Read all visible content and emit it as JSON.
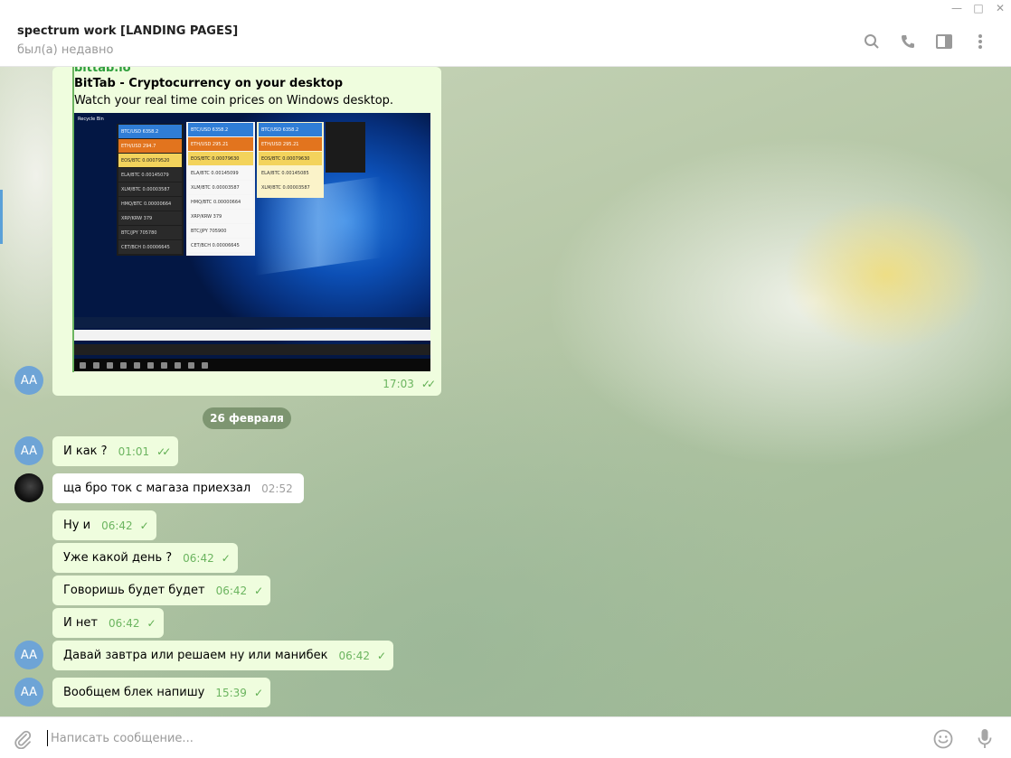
{
  "header": {
    "title": "spectrum work [LANDING PAGES]",
    "status": "был(а) недавно"
  },
  "link_preview": {
    "site": "bittab.io",
    "title": "BitTab - Cryptocurrency on your desktop",
    "description": "Watch your real time coin prices on Windows desktop.",
    "time": "17:03",
    "image_rows": {
      "col1": [
        "BTC/USD 6358.2",
        "ETH/USD 294.7",
        "EOS/BTC 0.00079520",
        "ELA/BTC 0.00145079",
        "XLM/BTC 0.00003587",
        "HMQ/BTC 0.00000664",
        "XRP/KRW 379",
        "BTC/JPY 705780",
        "CET/BCH 0.00006645"
      ],
      "col2": [
        "BTC/USD 6358.2",
        "ETH/USD 295.21",
        "EOS/BTC 0.00079630",
        "ELA/BTC 0.00145099",
        "XLM/BTC 0.00003587",
        "HMQ/BTC 0.00000664",
        "XRP/KRW 379",
        "BTC/JPY 705900",
        "CET/BCH 0.00006645"
      ],
      "col3": [
        "BTC/USD 6358.2",
        "ETH/USD 295.21",
        "EOS/BTC 0.00079630",
        "ELA/BTC 0.00145085",
        "XLM/BTC 0.00003587"
      ]
    },
    "recycle_label": "Recycle Bin"
  },
  "date_separator": "26 февраля",
  "messages": [
    {
      "avatar": "AA",
      "text": "И как ?",
      "time": "01:01",
      "check": "✓✓"
    },
    {
      "avatar": "",
      "text": "ща бро ток с магаза приехзал",
      "time": "02:52",
      "check": ""
    },
    {
      "avatar": "",
      "text": "Ну и",
      "time": "06:42",
      "check": "✓"
    },
    {
      "avatar": "",
      "text": "Уже какой день ?",
      "time": "06:42",
      "check": "✓"
    },
    {
      "avatar": "",
      "text": "Говоришь будет будет",
      "time": "06:42",
      "check": "✓"
    },
    {
      "avatar": "",
      "text": "И нет",
      "time": "06:42",
      "check": "✓"
    },
    {
      "avatar": "AA",
      "text": "Давай завтра или решаем ну или манибек",
      "time": "06:42",
      "check": "✓"
    },
    {
      "avatar": "AA",
      "text": "Вообщем блек напишу",
      "time": "15:39",
      "check": "✓"
    }
  ],
  "avatar_link": "AA",
  "input": {
    "placeholder": "Написать сообщение..."
  },
  "icons": {
    "search": "search-icon",
    "call": "phone-icon",
    "sidebar": "sidebar-toggle-icon",
    "more": "more-vertical-icon",
    "attach": "paperclip-icon",
    "emoji": "emoji-icon",
    "mic": "microphone-icon"
  },
  "colors": {
    "bubble_out": "#effdde",
    "bubble_in": "#ffffff",
    "accent": "#6cb560",
    "avatar": "#6ea4d6"
  }
}
